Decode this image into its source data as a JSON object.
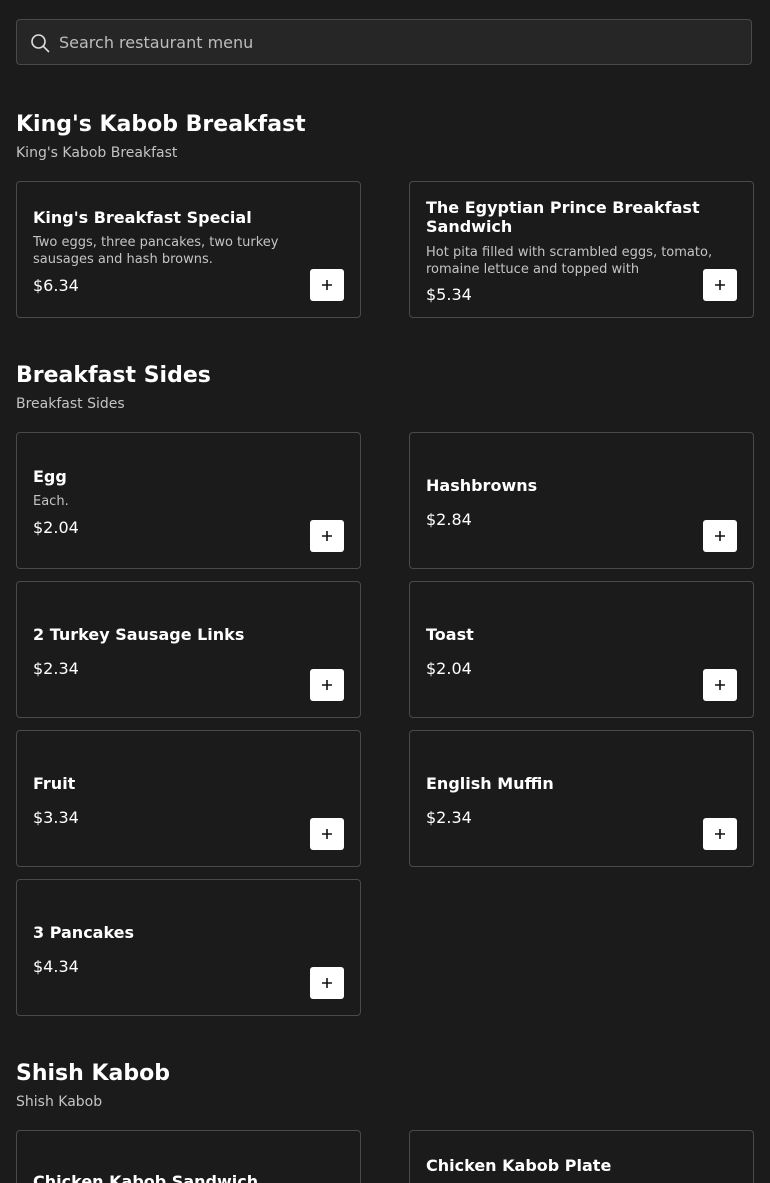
{
  "search": {
    "placeholder": "Search restaurant menu",
    "value": ""
  },
  "sections": [
    {
      "title": "King's Kabob Breakfast",
      "subtitle": "King's Kabob Breakfast",
      "items": [
        {
          "name": "King's Breakfast Special",
          "description": "Two eggs, three pancakes, two turkey sausages and hash browns.",
          "price": "$6.34"
        },
        {
          "name": "The Egyptian Prince Breakfast Sandwich",
          "description": "Hot pita filled with scrambled eggs, tomato, romaine lettuce and topped with",
          "price": "$5.34"
        }
      ]
    },
    {
      "title": "Breakfast Sides",
      "subtitle": "Breakfast Sides",
      "items": [
        {
          "name": "Egg",
          "description": "Each.",
          "price": "$2.04"
        },
        {
          "name": "Hashbrowns",
          "description": "",
          "price": "$2.84"
        },
        {
          "name": "2 Turkey Sausage Links",
          "description": "",
          "price": "$2.34"
        },
        {
          "name": "Toast",
          "description": "",
          "price": "$2.04"
        },
        {
          "name": "Fruit",
          "description": "",
          "price": "$3.34"
        },
        {
          "name": "English Muffin",
          "description": "",
          "price": "$2.34"
        },
        {
          "name": "3 Pancakes",
          "description": "",
          "price": "$4.34"
        }
      ]
    },
    {
      "title": "Shish Kabob",
      "subtitle": "Shish Kabob",
      "items": [
        {
          "name": "Chicken Kabob Sandwich",
          "description": "",
          "price": ""
        },
        {
          "name": "Chicken Kabob Plate",
          "description": "",
          "price": ""
        }
      ]
    }
  ],
  "icons": {
    "search": "search-icon",
    "add": "plus-icon"
  }
}
